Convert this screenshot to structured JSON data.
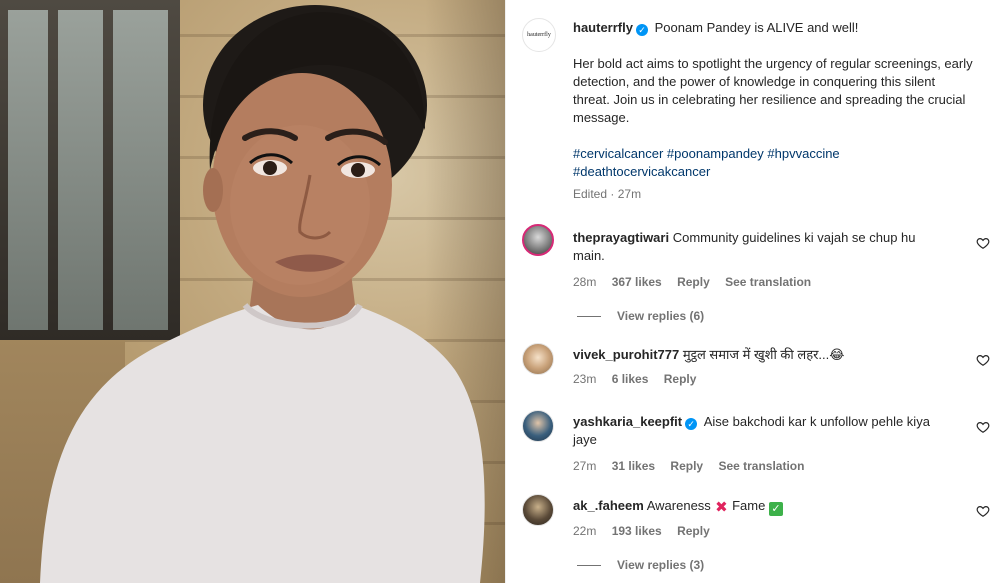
{
  "post": {
    "author": "hauterrfly",
    "avatar_text": "hauterrfly",
    "headline": "Poonam Pandey is ALIVE and well!",
    "body": "Her bold act aims to spotlight the urgency of regular screenings, early detection, and the power of knowledge in conquering this silent threat. Join us in celebrating her resilience and spreading the crucial message.",
    "hashtags_line1": "#cervicalcancer #poonampandey #hpvvaccine",
    "hashtags_line2": "#deathtocervicakcancer",
    "edited_label": "Edited",
    "time": "27m"
  },
  "comments": [
    {
      "username": "theprayagtiwari",
      "text_line1": "Community guidelines ki vajah se chup hu",
      "text_line2": "main.",
      "time": "28m",
      "likes": "367 likes",
      "reply": "Reply",
      "translate": "See translation",
      "view_replies": "View replies (6)"
    },
    {
      "username": "vivek_purohit777",
      "text": "मुट्ठल समाज में खुशी की लहर...😂",
      "time": "23m",
      "likes": "6 likes",
      "reply": "Reply"
    },
    {
      "username": "yashkaria_keepfit",
      "text_line1": "Aise bakchodi kar k unfollow pehle kiya",
      "text_line2": "jaye",
      "time": "27m",
      "likes": "31 likes",
      "reply": "Reply",
      "translate": "See translation"
    },
    {
      "username": "ak_.faheem",
      "text_part1": "Awareness",
      "text_part2": "Fame",
      "time": "22m",
      "likes": "193 likes",
      "reply": "Reply",
      "view_replies": "View replies (3)"
    }
  ],
  "icons": {
    "verified": "verified-badge-icon",
    "heart": "heart-outline-icon",
    "cross_mark": "red-x-emoji",
    "check_mark": "green-check-emoji"
  },
  "colors": {
    "verified": "#0095f6",
    "link": "#00376b",
    "muted": "#737373"
  }
}
